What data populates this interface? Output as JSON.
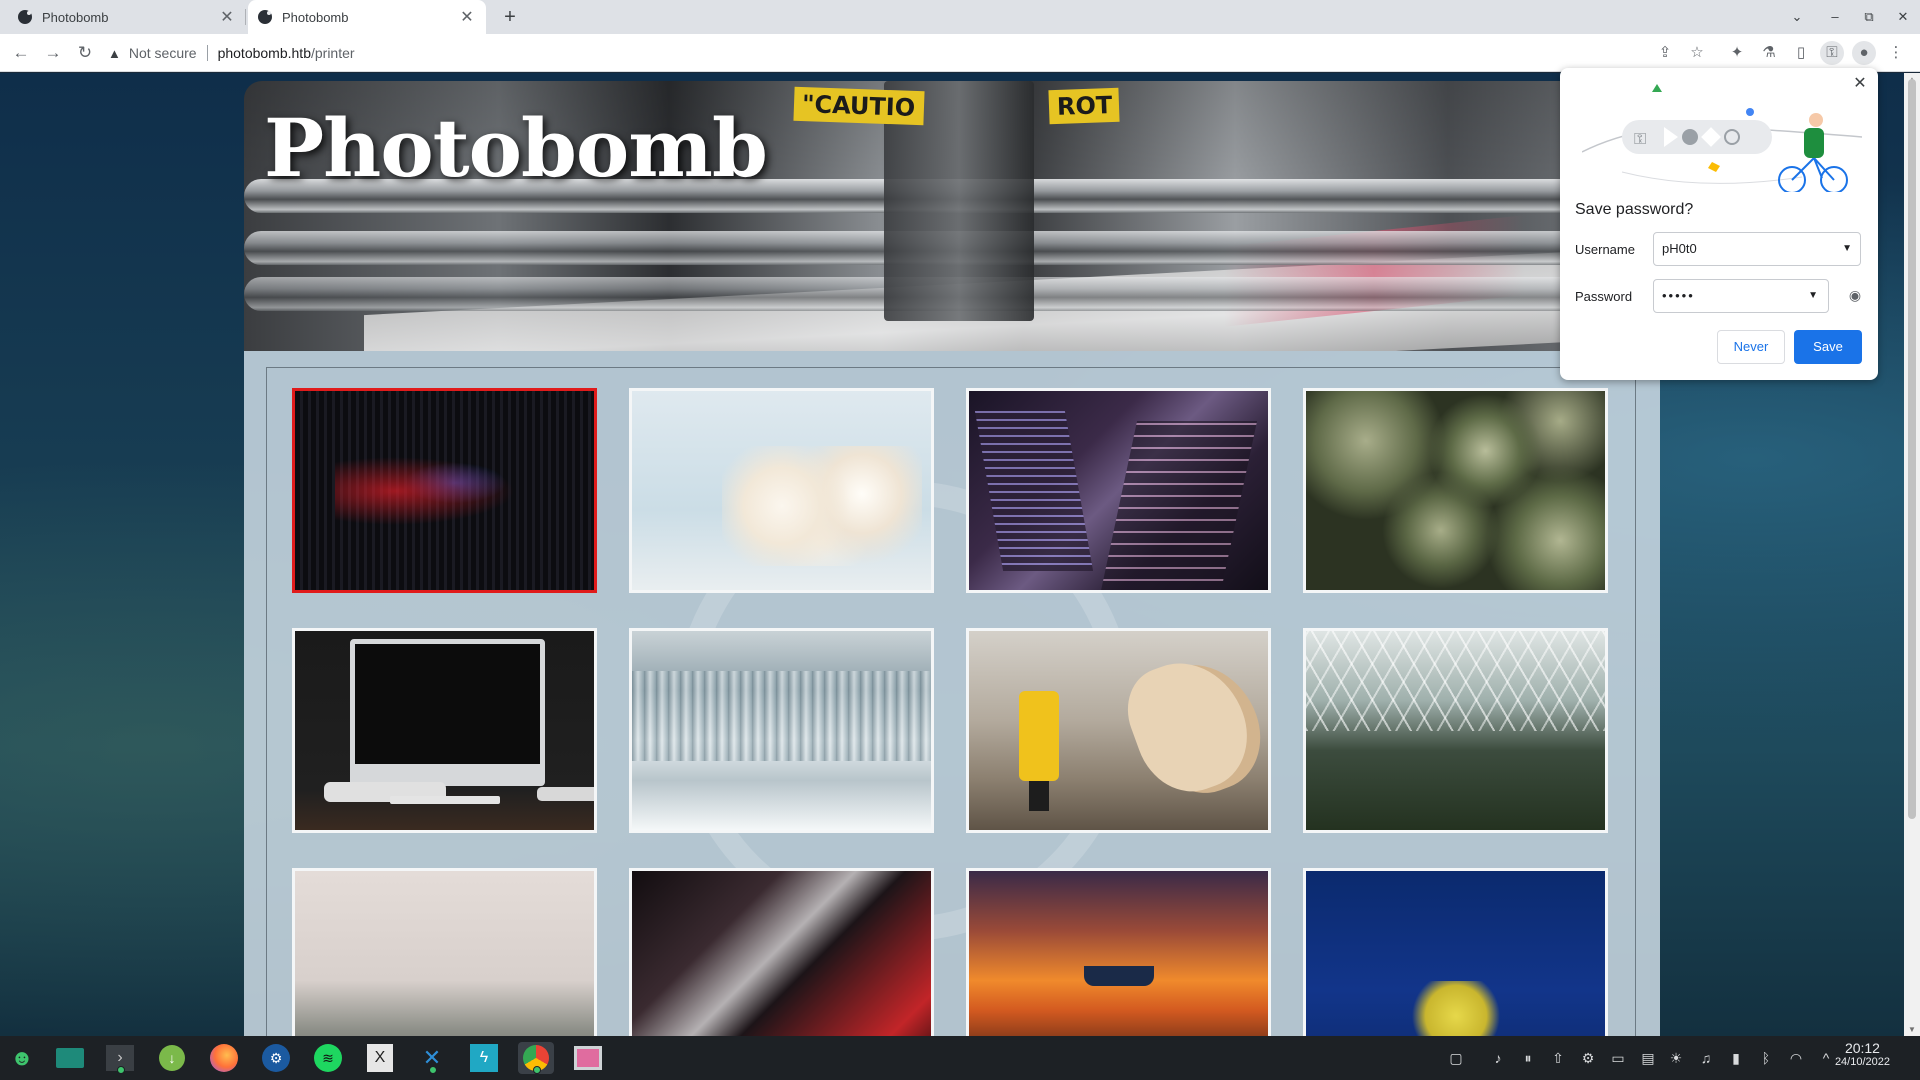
{
  "browser": {
    "tabs": [
      {
        "label": "Photobomb",
        "active": false
      },
      {
        "label": "Photobomb",
        "active": true
      }
    ],
    "new_tab_label": "+",
    "window_controls": [
      "⌄",
      "–",
      "⧉",
      "✕"
    ],
    "address": {
      "security_label": "Not secure",
      "host": "photobomb.htb",
      "path": "/printer"
    }
  },
  "page": {
    "site_title": "Photobomb",
    "header_signs": [
      "\"CAUTIO",
      "ROT"
    ],
    "gallery_items": [
      {
        "art": "red-light-abstract",
        "selected": true
      },
      {
        "art": "white-blossom-branch",
        "selected": false
      },
      {
        "art": "skyscrapers-night",
        "selected": false
      },
      {
        "art": "succulent-plants",
        "selected": false
      },
      {
        "art": "computer-desk",
        "selected": false
      },
      {
        "art": "frozen-waterfall",
        "selected": false
      },
      {
        "art": "wood-workshop",
        "selected": false
      },
      {
        "art": "greenhouse-interior",
        "selected": false
      },
      {
        "art": "misty-coast",
        "selected": false
      },
      {
        "art": "red-chrome-curves",
        "selected": false
      },
      {
        "art": "boat-sunset",
        "selected": false
      },
      {
        "art": "yellow-tree-blue-sky",
        "selected": false
      }
    ]
  },
  "password_bubble": {
    "heading": "Save password?",
    "username_label": "Username",
    "username_value": "pH0t0",
    "password_label": "Password",
    "password_value": "•••••",
    "never_label": "Never",
    "save_label": "Save",
    "accent_color": "#1a73e8"
  },
  "taskbar": {
    "apps": [
      "alien-icon",
      "file-manager-icon",
      "terminal-icon",
      "download-icon",
      "firefox-icon",
      "steam-icon",
      "spotify-icon",
      "xournal-icon",
      "vscode-icon",
      "lightning-icon",
      "chrome-icon",
      "screenshot-icon"
    ],
    "clock": {
      "time": "20:12",
      "date": "24/10/2022"
    }
  }
}
